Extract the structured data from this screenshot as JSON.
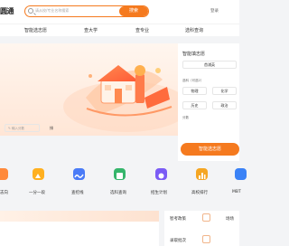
{
  "header": {
    "logo": "圆通",
    "search_placeholder": "请从校/专业名称搜索",
    "search_button": "搜索",
    "login": "登录"
  },
  "nav": {
    "items": [
      "智能选志愿",
      "查大学",
      "查专业",
      "选科查询"
    ]
  },
  "panel": {
    "title": "智能填志愿",
    "province": "首浦英",
    "subjects_label": "选科（可选2）",
    "subjects": [
      "物理",
      "化学",
      "历史",
      "政治"
    ],
    "score_label": "分数",
    "score_placeholder": "输入分数",
    "rank_button": "排",
    "rank_placeholder": "输入排",
    "cta": "智能选志愿"
  },
  "tools": [
    {
      "label": "志向",
      "color": "#ff8a3c"
    },
    {
      "label": "一分一段",
      "color": "#ffb020"
    },
    {
      "label": "查挖线",
      "color": "#4a7bf7"
    },
    {
      "label": "选科查询",
      "color": "#35b56b"
    },
    {
      "label": "招生计划",
      "color": "#7b5cf5"
    },
    {
      "label": "高校排行",
      "color": "#f5a623"
    },
    {
      "label": "MBT",
      "color": "#3b82f6"
    }
  ],
  "bottom_right": {
    "items": [
      "智考政策",
      "录取批次"
    ],
    "extra": "场场"
  },
  "colors": {
    "accent": "#f57a1f",
    "page_bg": "#f3f4f6"
  }
}
